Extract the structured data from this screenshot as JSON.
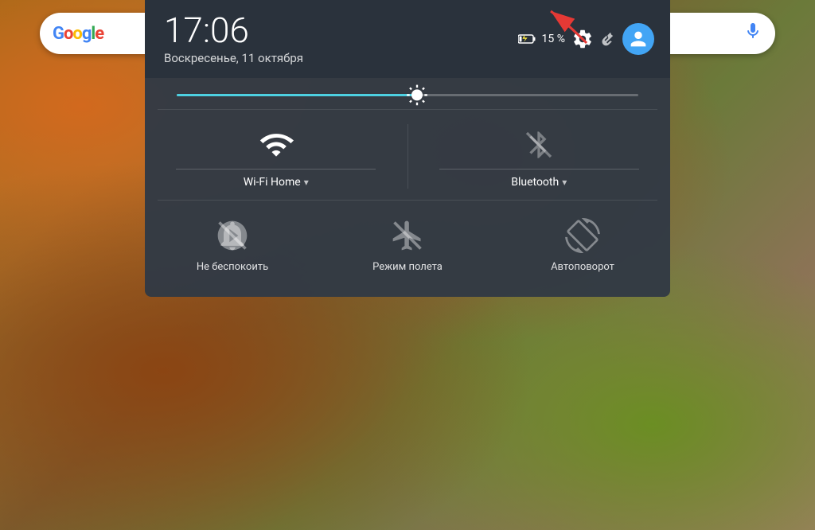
{
  "wallpaper": {
    "description": "earthy landscape aerial view"
  },
  "searchbar": {
    "logo": "Google",
    "mic_label": "Voice search"
  },
  "qs_panel": {
    "time": "17:06",
    "date": "Воскресенье, 11 октября",
    "battery_percent": "15 %",
    "settings_label": "Settings",
    "wrench_label": "Tools",
    "avatar_label": "User account",
    "brightness_value": 52,
    "toggles": [
      {
        "id": "wifi",
        "label": "Wi-Fi Home",
        "active": true,
        "has_dropdown": true
      },
      {
        "id": "bluetooth",
        "label": "Bluetooth",
        "active": false,
        "has_dropdown": true
      }
    ],
    "bottom_toggles": [
      {
        "id": "dnd",
        "label": "Не беспокоить",
        "active": false
      },
      {
        "id": "airplane",
        "label": "Режим полета",
        "active": false
      },
      {
        "id": "autorotate",
        "label": "Автоповорот",
        "active": false
      }
    ]
  }
}
